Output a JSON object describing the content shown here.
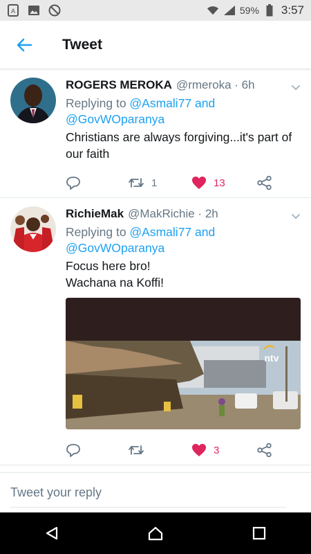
{
  "status_bar": {
    "battery": "59%",
    "time": "3:57"
  },
  "header": {
    "title": "Tweet"
  },
  "tweets": [
    {
      "name": "ROGERS MEROKA",
      "handle": "@rmeroka · 6h",
      "replying_prefix": "Replying to ",
      "replying_targets": "@Asmali77 and @GovWOparanya",
      "text": "Christians are always forgiving...it's part of our faith",
      "retweets": "1",
      "likes": "13"
    },
    {
      "name": "RichieMak",
      "handle": "@MakRichie · 2h",
      "replying_prefix": "Replying to ",
      "replying_targets": "@Asmali77 and @GovWOparanya",
      "text": "Focus here bro!\nWachana na Koffi!",
      "media_logo": "ntv",
      "retweets": "",
      "likes": "3"
    }
  ],
  "reply": {
    "placeholder": "Tweet your reply"
  },
  "colors": {
    "accent": "#1da1f2",
    "like": "#e0245e",
    "muted": "#657786"
  }
}
